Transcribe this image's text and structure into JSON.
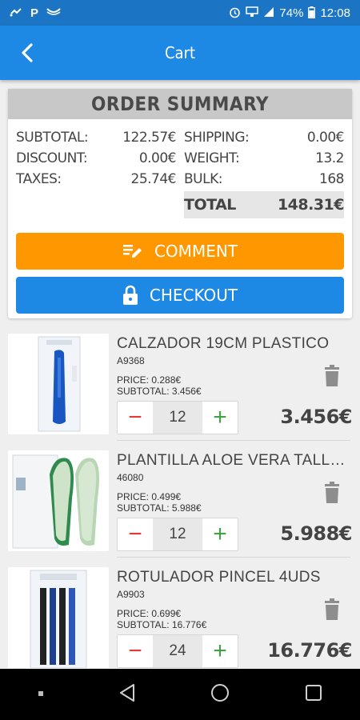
{
  "status_bar": {
    "battery": "74%",
    "time": "12:08",
    "icons": [
      "sync-icon",
      "paypal-icon",
      "mail-icon",
      "alarm-icon",
      "wifi-icon",
      "signal-icon",
      "battery-icon"
    ]
  },
  "header": {
    "title": "Cart",
    "back_icon": "chevron-left-icon"
  },
  "summary": {
    "title": "ORDER SUMMARY",
    "left": [
      {
        "label": "SUBTOTAL:",
        "value": "122.57€"
      },
      {
        "label": "DISCOUNT:",
        "value": "0.00€"
      },
      {
        "label": "TAXES:",
        "value": "25.74€"
      }
    ],
    "right": [
      {
        "label": "SHIPPING:",
        "value": "0.00€"
      },
      {
        "label": "WEIGHT:",
        "value": "13.2"
      },
      {
        "label": "BULK:",
        "value": "168"
      }
    ],
    "total_label": "TOTAL",
    "total_value": "148.31€",
    "comment_label": "COMMENT",
    "checkout_label": "CHECKOUT"
  },
  "items": [
    {
      "name": "CALZADOR 19CM PLASTICO",
      "code": "A9368",
      "price": "PRICE: 0.288€",
      "subtotal": "SUBTOTAL: 3.456€",
      "qty": "12",
      "total": "3.456€"
    },
    {
      "name": "PLANTILLA ALOE VERA TALLA UNICA",
      "code": "46080",
      "price": "PRICE: 0.499€",
      "subtotal": "SUBTOTAL: 5.988€",
      "qty": "12",
      "total": "5.988€"
    },
    {
      "name": "ROTULADOR PINCEL 4UDS",
      "code": "A9903",
      "price": "PRICE: 0.699€",
      "subtotal": "SUBTOTAL: 16.776€",
      "qty": "24",
      "total": "16.776€"
    }
  ],
  "qty_controls": {
    "minus": "−",
    "plus": "+"
  },
  "colors": {
    "primary": "#1e88e5",
    "status_bar": "#1b75c4",
    "comment": "#ff9800",
    "minus": "#e53935",
    "plus": "#43a047"
  }
}
